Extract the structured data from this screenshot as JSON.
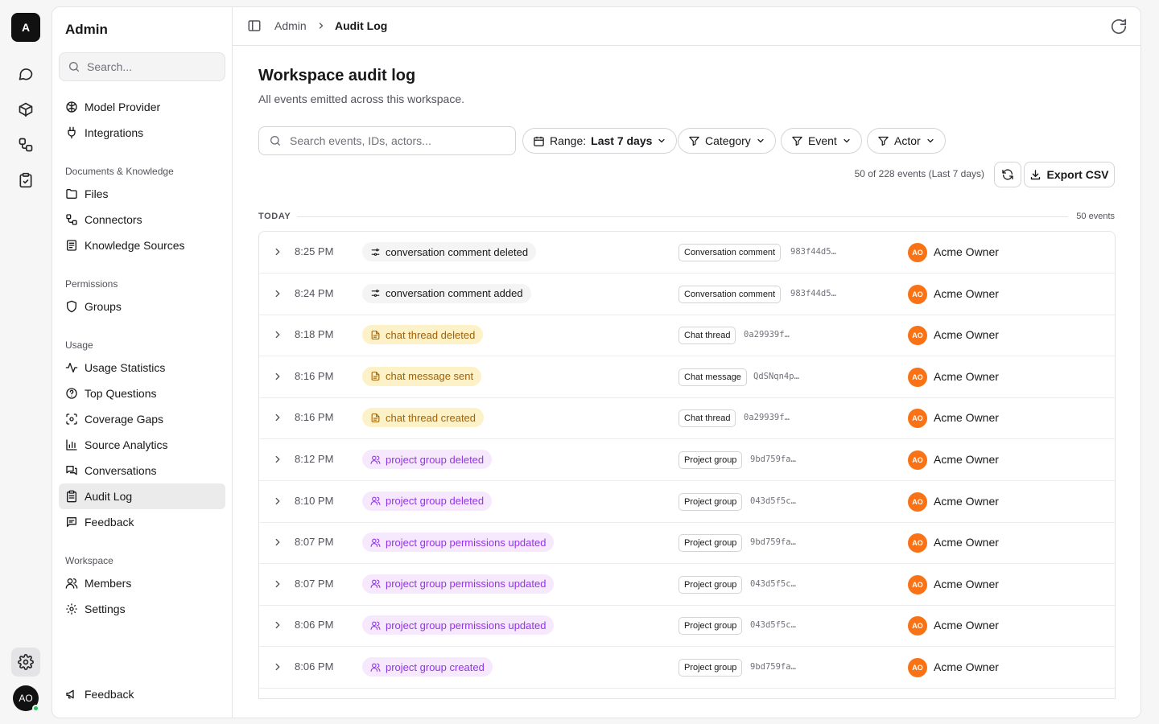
{
  "rail": {
    "logo": "A",
    "icons": [
      "chat-icon",
      "cube-icon",
      "workflow-icon",
      "clipboard-check-icon",
      "gear-icon"
    ],
    "avatar": "AO"
  },
  "sidebar": {
    "title": "Admin",
    "search_placeholder": "Search...",
    "top_items": [
      {
        "label": "Model Provider",
        "icon": "brain-icon"
      },
      {
        "label": "Integrations",
        "icon": "plug-icon"
      }
    ],
    "sections": [
      {
        "label": "Documents & Knowledge",
        "items": [
          {
            "label": "Files",
            "icon": "folder-icon"
          },
          {
            "label": "Connectors",
            "icon": "connector-icon"
          },
          {
            "label": "Knowledge Sources",
            "icon": "book-icon"
          }
        ]
      },
      {
        "label": "Permissions",
        "items": [
          {
            "label": "Groups",
            "icon": "shield-icon"
          }
        ]
      },
      {
        "label": "Usage",
        "items": [
          {
            "label": "Usage Statistics",
            "icon": "activity-icon"
          },
          {
            "label": "Top Questions",
            "icon": "help-circle-icon"
          },
          {
            "label": "Coverage Gaps",
            "icon": "scan-icon"
          },
          {
            "label": "Source Analytics",
            "icon": "bar-chart-icon"
          },
          {
            "label": "Conversations",
            "icon": "messages-icon"
          },
          {
            "label": "Audit Log",
            "icon": "clipboard-icon",
            "active": true
          },
          {
            "label": "Feedback",
            "icon": "message-square-text-icon"
          }
        ]
      },
      {
        "label": "Workspace",
        "items": [
          {
            "label": "Members",
            "icon": "users-icon"
          },
          {
            "label": "Settings",
            "icon": "settings-icon"
          }
        ]
      }
    ],
    "footer_item": {
      "label": "Feedback",
      "icon": "megaphone-icon"
    }
  },
  "breadcrumb": {
    "parent": "Admin",
    "current": "Audit Log"
  },
  "page": {
    "title": "Workspace audit log",
    "subtitle": "All events emitted across this workspace."
  },
  "filters": {
    "search_placeholder": "Search events, IDs, actors...",
    "range_label": "Range:",
    "range_value": "Last 7 days",
    "category": "Category",
    "event": "Event",
    "actor": "Actor"
  },
  "summary": {
    "count_text": "50 of 228 events (Last 7 days)",
    "export_label": "Export CSV"
  },
  "group": {
    "label": "TODAY",
    "count": "50 events"
  },
  "events": [
    {
      "time": "8:25 PM",
      "event": "conversation comment deleted",
      "style": "gray",
      "icon": "workflow-icon",
      "resource": "Conversation comment",
      "id": "983f44d5…",
      "actor": "Acme Owner",
      "actor_initials": "AO"
    },
    {
      "time": "8:24 PM",
      "event": "conversation comment added",
      "style": "gray",
      "icon": "workflow-icon",
      "resource": "Conversation comment",
      "id": "983f44d5…",
      "actor": "Acme Owner",
      "actor_initials": "AO"
    },
    {
      "time": "8:18 PM",
      "event": "chat thread deleted",
      "style": "yellow",
      "icon": "file-text-icon",
      "resource": "Chat thread",
      "id": "0a29939f…",
      "actor": "Acme Owner",
      "actor_initials": "AO"
    },
    {
      "time": "8:16 PM",
      "event": "chat message sent",
      "style": "yellow",
      "icon": "file-text-icon",
      "resource": "Chat message",
      "id": "QdSNqn4p…",
      "actor": "Acme Owner",
      "actor_initials": "AO"
    },
    {
      "time": "8:16 PM",
      "event": "chat thread created",
      "style": "yellow",
      "icon": "file-text-icon",
      "resource": "Chat thread",
      "id": "0a29939f…",
      "actor": "Acme Owner",
      "actor_initials": "AO"
    },
    {
      "time": "8:12 PM",
      "event": "project group deleted",
      "style": "purple",
      "icon": "users-icon",
      "resource": "Project group",
      "id": "9bd759fa…",
      "actor": "Acme Owner",
      "actor_initials": "AO"
    },
    {
      "time": "8:10 PM",
      "event": "project group deleted",
      "style": "purple",
      "icon": "users-icon",
      "resource": "Project group",
      "id": "043d5f5c…",
      "actor": "Acme Owner",
      "actor_initials": "AO"
    },
    {
      "time": "8:07 PM",
      "event": "project group permissions updated",
      "style": "purple",
      "icon": "users-icon",
      "resource": "Project group",
      "id": "9bd759fa…",
      "actor": "Acme Owner",
      "actor_initials": "AO"
    },
    {
      "time": "8:07 PM",
      "event": "project group permissions updated",
      "style": "purple",
      "icon": "users-icon",
      "resource": "Project group",
      "id": "043d5f5c…",
      "actor": "Acme Owner",
      "actor_initials": "AO"
    },
    {
      "time": "8:06 PM",
      "event": "project group permissions updated",
      "style": "purple",
      "icon": "users-icon",
      "resource": "Project group",
      "id": "043d5f5c…",
      "actor": "Acme Owner",
      "actor_initials": "AO"
    },
    {
      "time": "8:06 PM",
      "event": "project group created",
      "style": "purple",
      "icon": "users-icon",
      "resource": "Project group",
      "id": "9bd759fa…",
      "actor": "Acme Owner",
      "actor_initials": "AO"
    }
  ],
  "colors": {
    "accent": "#f97316",
    "yellow_pill": "#fdf1c7",
    "purple_pill": "#f6e8fd",
    "status_online": "#22c55e"
  }
}
